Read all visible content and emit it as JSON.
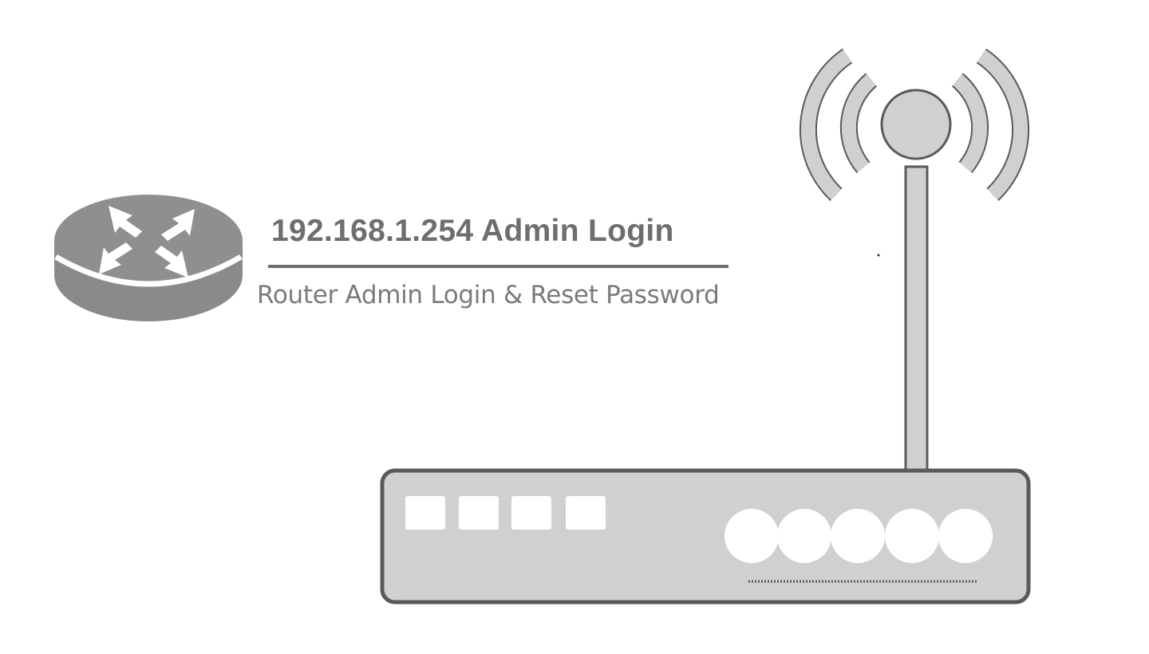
{
  "header": {
    "title": "192.168.1.254 Admin Login",
    "subtitle": "Router Admin Login & Reset Password"
  },
  "icons": {
    "router_symbol": "router-symbol-icon",
    "wifi_router": "wifi-router-icon",
    "signal_waves": "wifi-signal-icon"
  },
  "colors": {
    "primary_gray": "#6e6e6e",
    "light_gray": "#d0d0d0",
    "background": "#ffffff"
  }
}
